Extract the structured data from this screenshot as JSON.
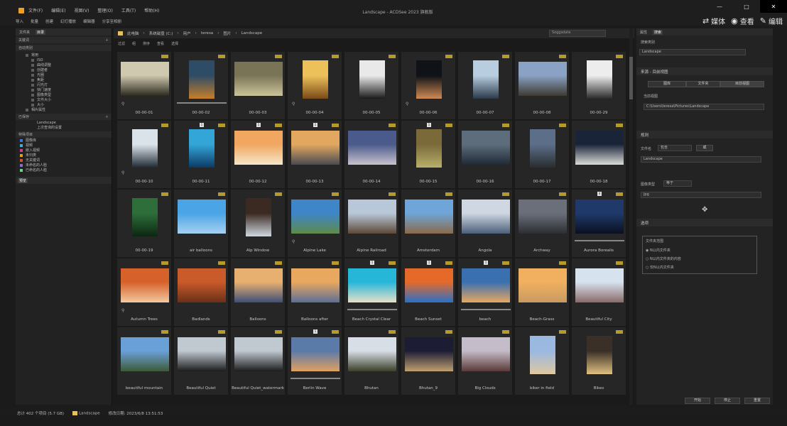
{
  "window": {
    "title": "Landscape - ACDSee 2023 旗舰版",
    "menu": [
      "文件(F)",
      "编辑(E)",
      "视图(V)",
      "整理(O)",
      "工具(T)",
      "帮助(H)"
    ],
    "toolbar": [
      "导入",
      "批量",
      "创建",
      "幻灯播放",
      "编辑器",
      "分享至相册"
    ],
    "mode_tabs": [
      {
        "label": "媒体",
        "icon": "media-icon"
      },
      {
        "label": "查看",
        "icon": "eye-icon"
      },
      {
        "label": "编辑",
        "icon": "edit-icon"
      }
    ],
    "controls": [
      "—",
      "□",
      "✕"
    ]
  },
  "left_pane": {
    "tabs": [
      "文件夹",
      "目录"
    ],
    "catalog_header": "关键词",
    "search_header": "自动类别",
    "tree": [
      "常用",
      "ISO",
      "曲线调整",
      "创建者",
      "光圈",
      "焦距",
      "闪光灯",
      "快门速度",
      "图像类型",
      "文件大小",
      "大小",
      "相片属性"
    ],
    "saved_header": "已保存",
    "saved_items": [
      "Landscape",
      "上次查询的设置"
    ],
    "special_header": "特殊项目",
    "special_items": [
      "图像库",
      "视频",
      "嵌入视频",
      "未归类",
      "无关键词",
      "未命名的人脸",
      "已命名的人脸"
    ],
    "preview_tab": "预览"
  },
  "path_bar": {
    "crumbs": [
      "此电脑",
      "系统磁盘 (C:)",
      "用户",
      "teresa",
      "图片",
      "Landscape"
    ],
    "search_value": "Soggsdate"
  },
  "view_bar": [
    "过滤",
    "组",
    "排序",
    "查看",
    "选择"
  ],
  "thumbs": [
    {
      "name": "00-00-01",
      "colors": [
        "#cfc9b0",
        "#2d2a20"
      ],
      "shape": "wide",
      "pin": true
    },
    {
      "name": "00-00-02",
      "colors": [
        "#2f4c66",
        "#c77e2a"
      ],
      "shape": "tall",
      "prog": true
    },
    {
      "name": "00-00-03",
      "colors": [
        "#7a7456",
        "#cbc39a"
      ],
      "shape": "wide"
    },
    {
      "name": "00-00-04",
      "colors": [
        "#ecc15a",
        "#7a4a18"
      ],
      "shape": "tall",
      "pin": true
    },
    {
      "name": "00-00-05",
      "colors": [
        "#e9e9e9",
        "#1a1a1a"
      ],
      "shape": "tall"
    },
    {
      "name": "00-00-06",
      "colors": [
        "#0f1216",
        "#cf8a55"
      ],
      "shape": "tall",
      "pin": true
    },
    {
      "name": "00-00-07",
      "colors": [
        "#b8cde0",
        "#2a3a4a"
      ],
      "shape": "tall"
    },
    {
      "name": "00-00-08",
      "colors": [
        "#8aa2c4",
        "#3d3a32"
      ],
      "shape": "wide"
    },
    {
      "name": "00-00-29",
      "colors": [
        "#ededed",
        "#2a2a2a"
      ],
      "shape": "tall"
    },
    {
      "name": "00-00-10",
      "colors": [
        "#dbe3ea",
        "#202a34"
      ],
      "shape": "tall",
      "pin": true
    },
    {
      "name": "00-00-11",
      "colors": [
        "#33a5d6",
        "#0c3a66"
      ],
      "shape": "tall",
      "cnt": "1"
    },
    {
      "name": "00-00-12",
      "colors": [
        "#f1a760",
        "#f5e6c8"
      ],
      "shape": "wide",
      "cnt": "1"
    },
    {
      "name": "00-00-13",
      "colors": [
        "#e3a860",
        "#4a4a52"
      ],
      "shape": "wide",
      "cnt": "1"
    },
    {
      "name": "00-00-14",
      "colors": [
        "#4a5a8a",
        "#c9c2cf"
      ],
      "shape": "wide"
    },
    {
      "name": "00-00-15",
      "colors": [
        "#7a6a3a",
        "#b8b06a"
      ],
      "shape": "tall",
      "cnt": "1"
    },
    {
      "name": "00-00-16",
      "colors": [
        "#5d6d7c",
        "#1f2a36"
      ],
      "shape": "wide"
    },
    {
      "name": "00-00-17",
      "colors": [
        "#5c6e88",
        "#2a2d30"
      ],
      "shape": "tall"
    },
    {
      "name": "00-00-18",
      "colors": [
        "#1a2438",
        "#dbdcd8"
      ],
      "shape": "wide"
    },
    {
      "name": "00-00-19",
      "colors": [
        "#2d6e3a",
        "#0c2612"
      ],
      "shape": "tall"
    },
    {
      "name": "air balloons",
      "colors": [
        "#4aa4e6",
        "#a6d1f0"
      ],
      "shape": "wide"
    },
    {
      "name": "Alp Window",
      "colors": [
        "#3b2a22",
        "#cfd8e0"
      ],
      "shape": "tall"
    },
    {
      "name": "Alpine Lake",
      "colors": [
        "#3f86c9",
        "#5e8a4a"
      ],
      "shape": "wide",
      "pin": true
    },
    {
      "name": "Alpine Railroad",
      "colors": [
        "#b9c8d8",
        "#5d4838"
      ],
      "shape": "wide"
    },
    {
      "name": "Amsterdam",
      "colors": [
        "#6fa5d8",
        "#8a6a4a"
      ],
      "shape": "wide"
    },
    {
      "name": "Angola",
      "colors": [
        "#cfd8e2",
        "#4c5e7a"
      ],
      "shape": "wide"
    },
    {
      "name": "Archway",
      "colors": [
        "#6a6f7a",
        "#2c2e32"
      ],
      "shape": "wide"
    },
    {
      "name": "Aurora Borealis",
      "colors": [
        "#1f3a6a",
        "#0a1020"
      ],
      "shape": "wide",
      "cnt": "4",
      "prog": true
    },
    {
      "name": "Autumn Trees",
      "colors": [
        "#d6612a",
        "#f2c9a0"
      ],
      "shape": "wide",
      "pin": true
    },
    {
      "name": "Badlands",
      "colors": [
        "#c95a2a",
        "#6a3018"
      ],
      "shape": "wide"
    },
    {
      "name": "Balloons",
      "colors": [
        "#e8b070",
        "#3d4f78"
      ],
      "shape": "wide"
    },
    {
      "name": "Balloons after",
      "colors": [
        "#e8a860",
        "#5c6e96"
      ],
      "shape": "wide"
    },
    {
      "name": "Beach Crystal Clear",
      "colors": [
        "#26b6d8",
        "#e8e0c8"
      ],
      "shape": "wide",
      "cnt": "1",
      "prog": true
    },
    {
      "name": "Beach Sunset",
      "colors": [
        "#e56a2a",
        "#2a70c8"
      ],
      "shape": "wide",
      "cnt": "1"
    },
    {
      "name": "beach",
      "colors": [
        "#3a6fb0",
        "#e8a860"
      ],
      "shape": "wide",
      "cnt": "1",
      "prog": true
    },
    {
      "name": "Beach-Grass",
      "colors": [
        "#f0b060",
        "#c89a60"
      ],
      "shape": "wide"
    },
    {
      "name": "Beautiful City",
      "colors": [
        "#d6e2ee",
        "#8a6a6a"
      ],
      "shape": "wide"
    },
    {
      "name": "beautiful mountain",
      "colors": [
        "#6aa0d8",
        "#3d5a38"
      ],
      "shape": "wide"
    },
    {
      "name": "Beautiful Quiet",
      "colors": [
        "#c0c8d0",
        "#1c1c1c"
      ],
      "shape": "wide"
    },
    {
      "name": "Beautiful Quiet_watermark",
      "colors": [
        "#c0c8d0",
        "#1c1c1c"
      ],
      "shape": "wide"
    },
    {
      "name": "Berlin Wave",
      "colors": [
        "#5a7aa8",
        "#e0a060"
      ],
      "shape": "wide",
      "cnt": "1",
      "prog": true
    },
    {
      "name": "Bhutan",
      "colors": [
        "#d8dee6",
        "#3a4028"
      ],
      "shape": "wide"
    },
    {
      "name": "Bhutan_9",
      "colors": [
        "#1c1c34",
        "#c0a070"
      ],
      "shape": "wide"
    },
    {
      "name": "Big Clouds",
      "colors": [
        "#c4bcc8",
        "#5a3a38"
      ],
      "shape": "wide"
    },
    {
      "name": "biker in field",
      "colors": [
        "#9ab8e0",
        "#e0c8a0"
      ],
      "shape": "tall"
    },
    {
      "name": "Bikes",
      "colors": [
        "#3a3028",
        "#e0c080"
      ],
      "shape": "tall"
    }
  ],
  "right_pane": {
    "tabs": [
      "属性",
      "搜索"
    ],
    "search_name_label": "搜索类别",
    "search_name_value": "Landscape",
    "section_source": "来源 - 目前视图",
    "source_tabs": [
      "图库",
      "文件夹",
      "目前视图"
    ],
    "current_label": "当前视图",
    "path_value": "C:\\Users\\teresa\\Pictures\\Landscape",
    "section_rules": "规则",
    "filename_label": "文件名",
    "contains_label": "包含",
    "operator": "或",
    "rule_value": "Landscape",
    "type_label": "图像类型",
    "equal_label": "等于",
    "type_value": "jpg",
    "section_options": "选项",
    "options_group": "文件夹范围",
    "options": [
      "N以内文件夹",
      "N以内文件夹的内容",
      "仅N以内文件夹"
    ],
    "buttons": [
      "开始",
      "停止",
      "重置"
    ]
  },
  "status": {
    "total": "总计 402 个项目 (5.7 GB)",
    "folder": "Landscape",
    "modified": "修改日期: 2023/6/8 13:51:53"
  }
}
